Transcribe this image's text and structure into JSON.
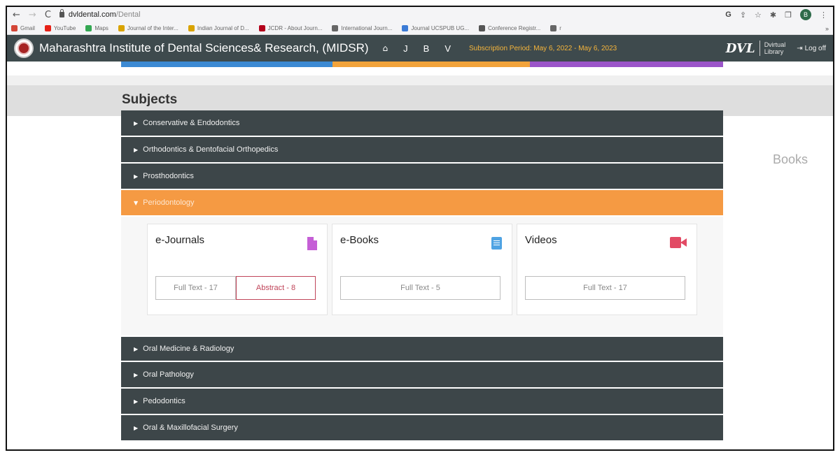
{
  "browser": {
    "nav": {
      "back": "←",
      "forward": "→",
      "reload": "C"
    },
    "url_host": "dvldental.com",
    "url_path": "/Dental",
    "right_icons": {
      "google": "G",
      "share": "⇪",
      "star": "☆",
      "ext": "✱",
      "window": "❐",
      "profile": "B",
      "menu": "⋮"
    }
  },
  "bookmarks": [
    {
      "label": "Gmail",
      "icon": "gmail-icon",
      "color": "#d44638"
    },
    {
      "label": "YouTube",
      "icon": "youtube-icon",
      "color": "#e62117"
    },
    {
      "label": "Maps",
      "icon": "maps-icon",
      "color": "#34a853"
    },
    {
      "label": "Journal of the Inter...",
      "icon": "globe-icon",
      "color": "#d9a300"
    },
    {
      "label": "Indian Journal of D...",
      "icon": "globe-icon",
      "color": "#d9a300"
    },
    {
      "label": "JCDR - About Journ...",
      "icon": "jcdr-icon",
      "color": "#b3001b"
    },
    {
      "label": "International Journ...",
      "icon": "globe-icon",
      "color": "#666666"
    },
    {
      "label": "Journal UCSPUB UG...",
      "icon": "ucspub-icon",
      "color": "#3b7bd6"
    },
    {
      "label": "Conference Registr...",
      "icon": "cup-icon",
      "color": "#555555"
    },
    {
      "label": "r",
      "icon": "globe-icon",
      "color": "#666666"
    }
  ],
  "bookmarks_more": "»",
  "site": {
    "institution": "Maharashtra Institute of Dental Sciences& Research, (MIDSR)",
    "nav": {
      "home": "⌂",
      "j": "J",
      "b": "B",
      "v": "V"
    },
    "subscription": "Subscription Period: May 6, 2022 - May 6, 2023",
    "logo": "DVL",
    "logo_sub1": "Dvirtual",
    "logo_sub2": "Library",
    "logoff": "Log off",
    "logoff_icon": "⇥"
  },
  "strip_colors": [
    "#3c8ad3",
    "#f2a33b",
    "#9b55c9"
  ],
  "page": {
    "ghost_books": "Books",
    "title": "Subjects",
    "subjects_top": [
      {
        "label": "Conservative & Endodontics"
      },
      {
        "label": "Orthodontics & Dentofacial Orthopedics"
      },
      {
        "label": "Prosthodontics"
      }
    ],
    "active_subject": "Periodontology",
    "cards": [
      {
        "title": "e-Journals",
        "icon": "document-icon",
        "buttons": [
          {
            "label": "Full Text - 17",
            "style": "plain"
          },
          {
            "label": "Abstract - 8",
            "style": "red"
          }
        ]
      },
      {
        "title": "e-Books",
        "icon": "book-icon",
        "buttons": [
          {
            "label": "Full Text - 5",
            "style": "plain"
          }
        ]
      },
      {
        "title": "Videos",
        "icon": "video-camera-icon",
        "buttons": [
          {
            "label": "Full Text - 17",
            "style": "plain"
          }
        ]
      }
    ],
    "subjects_bottom": [
      {
        "label": "Oral Medicine & Radiology"
      },
      {
        "label": "Oral Pathology"
      },
      {
        "label": "Pedodontics"
      },
      {
        "label": "Oral & Maxillofacial Surgery"
      }
    ],
    "caret_right": "▶",
    "caret_down": "▼"
  }
}
